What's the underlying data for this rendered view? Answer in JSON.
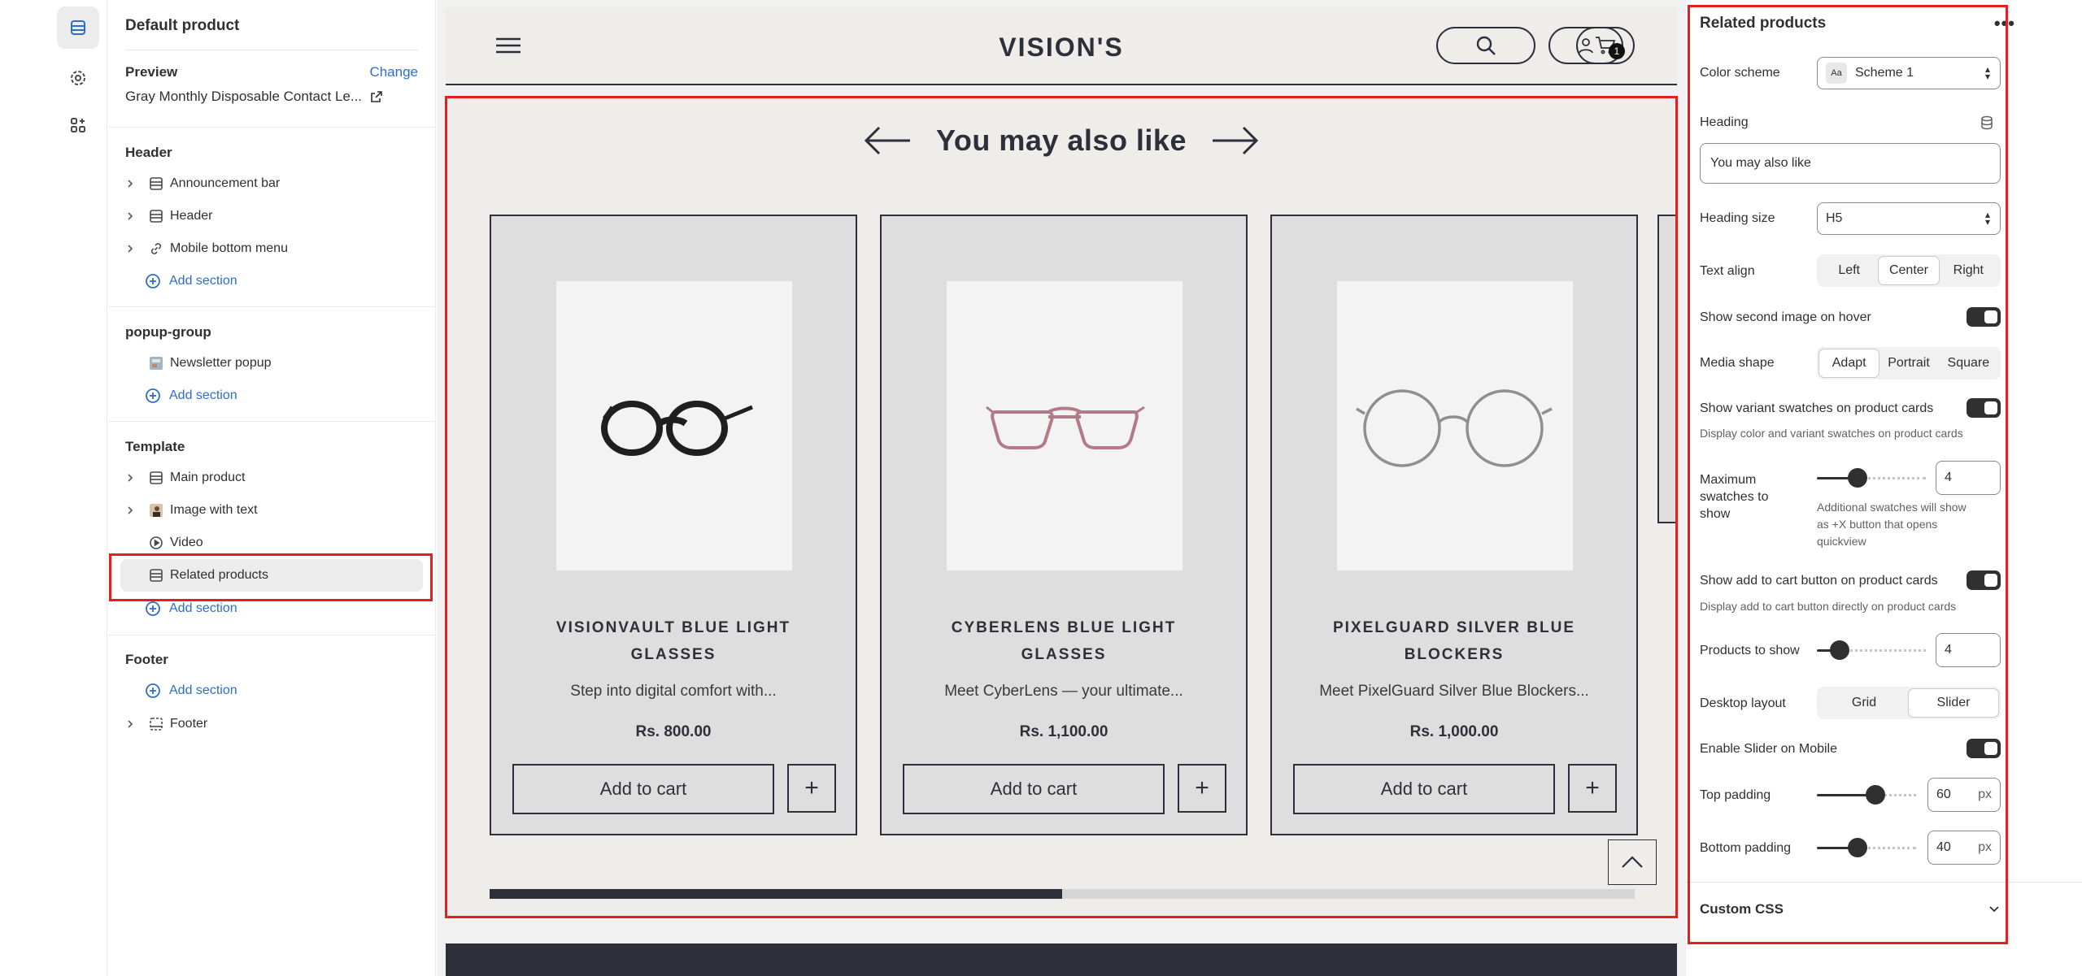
{
  "sidebar": {
    "title": "Default product",
    "preview_label": "Preview",
    "preview_change": "Change",
    "preview_value": "Gray Monthly Disposable Contact Le...",
    "sections": [
      {
        "heading": "Header",
        "items": [
          "Announcement bar",
          "Header",
          "Mobile bottom menu"
        ],
        "add": "Add section"
      },
      {
        "heading": "popup-group",
        "items": [
          "Newsletter popup"
        ],
        "add": "Add section"
      },
      {
        "heading": "Template",
        "items": [
          "Main product",
          "Image with text",
          "Video",
          "Related products"
        ],
        "add": "Add section"
      },
      {
        "heading": "Footer",
        "items": [
          "Footer"
        ],
        "add": "Add section"
      }
    ]
  },
  "store": {
    "logo": "VISION'S",
    "cart_count": "1",
    "related_heading": "You may also like",
    "products": [
      {
        "name_line1": "VISIONVAULT BLUE LIGHT",
        "name_line2": "GLASSES",
        "desc": "Step into digital comfort with...",
        "price": "Rs. 800.00",
        "button": "Add to cart",
        "plus": "+"
      },
      {
        "name_line1": "CYBERLENS BLUE LIGHT",
        "name_line2": "GLASSES",
        "desc": "Meet CyberLens — your ultimate...",
        "price": "Rs. 1,100.00",
        "button": "Add to cart",
        "plus": "+"
      },
      {
        "name_line1": "PIXELGUARD SILVER BLUE",
        "name_line2": "BLOCKERS",
        "desc": "Meet PixelGuard Silver Blue Blockers...",
        "price": "Rs. 1,000.00",
        "button": "Add to cart",
        "plus": "+"
      }
    ],
    "slider_progress": 0.5
  },
  "panel": {
    "title": "Related products",
    "more": "•••",
    "color_scheme_label": "Color scheme",
    "color_scheme_icon_text": "Aa",
    "color_scheme_value": "Scheme 1",
    "heading_label": "Heading",
    "heading_value": "You may also like",
    "heading_size_label": "Heading size",
    "heading_size_value": "H5",
    "text_align_label": "Text align",
    "text_align_options": [
      "Left",
      "Center",
      "Right"
    ],
    "text_align_selected": "Center",
    "second_image_label": "Show second image on hover",
    "media_shape_label": "Media shape",
    "media_shape_options": [
      "Adapt",
      "Portrait",
      "Square"
    ],
    "media_shape_selected": "Adapt",
    "variant_swatches_label": "Show variant swatches on product cards",
    "variant_swatches_help": "Display color and variant swatches on product cards",
    "max_swatches_label_1": "Maximum",
    "max_swatches_label_2": "swatches to",
    "max_swatches_label_3": "show",
    "max_swatches_value": "4",
    "max_swatches_help_1": "Additional swatches will show",
    "max_swatches_help_2": "as +X button that opens",
    "max_swatches_help_3": "quickview",
    "add_to_cart_label": "Show add to cart button on product cards",
    "add_to_cart_help": "Display add to cart button directly on product cards",
    "products_to_show_label": "Products to show",
    "products_to_show_value": "4",
    "desktop_layout_label": "Desktop layout",
    "desktop_layout_options": [
      "Grid",
      "Slider"
    ],
    "desktop_layout_selected": "Slider",
    "slider_mobile_label": "Enable Slider on Mobile",
    "top_padding_label": "Top padding",
    "top_padding_value": "60",
    "bottom_padding_label": "Bottom padding",
    "bottom_padding_value": "40",
    "unit": "px",
    "custom_css_label": "Custom CSS"
  }
}
